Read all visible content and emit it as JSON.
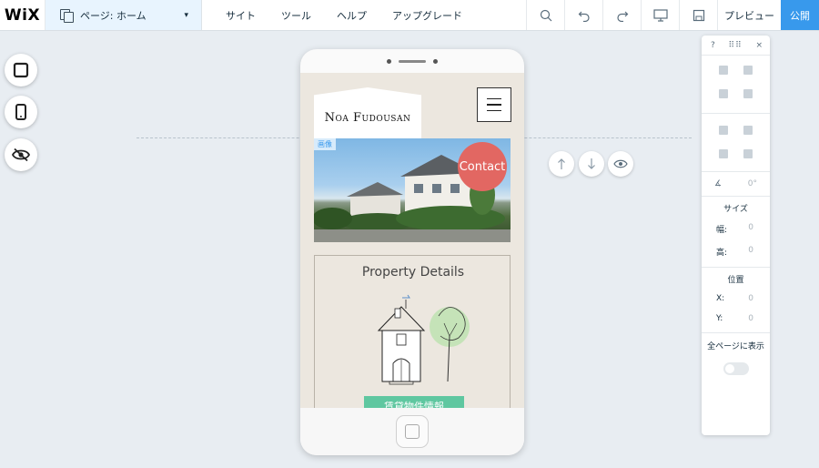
{
  "topbar": {
    "logo": "WiX",
    "page_selector": "ページ: ホーム",
    "menu": [
      "サイト",
      "ツール",
      "ヘルプ",
      "アップグレード"
    ],
    "preview": "プレビュー",
    "publish": "公開"
  },
  "site": {
    "logo_text": "Noa Fudousan",
    "image_tag": "画像",
    "contact_button": "Contact",
    "details_title": "Property Details",
    "cta_button": "賃貸物件情報"
  },
  "panel": {
    "help": "?",
    "close": "×",
    "rotation": "0°",
    "size_label": "サイズ",
    "width_label": "幅:",
    "width_value": "0",
    "height_label": "高:",
    "height_value": "0",
    "position_label": "位置",
    "x_label": "X:",
    "x_value": "0",
    "y_label": "Y:",
    "y_value": "0",
    "show_all_pages": "全ページに表示"
  },
  "colors": {
    "accent": "#3899ec",
    "contact": "#e26762",
    "cta": "#5fc7a0"
  }
}
